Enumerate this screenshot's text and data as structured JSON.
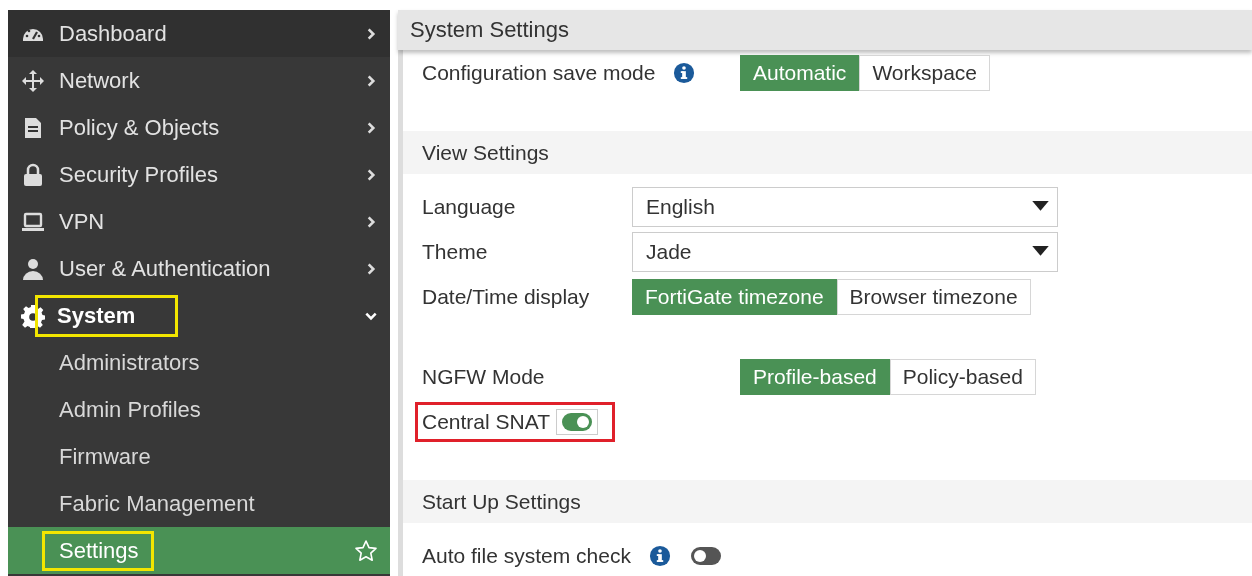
{
  "sidebar": {
    "items": [
      {
        "label": "Dashboard",
        "expanded": false,
        "selected": false,
        "highlight": false
      },
      {
        "label": "Network",
        "expanded": false,
        "selected": false,
        "highlight": false
      },
      {
        "label": "Policy & Objects",
        "expanded": false,
        "selected": false,
        "highlight": false
      },
      {
        "label": "Security Profiles",
        "expanded": false,
        "selected": false,
        "highlight": false
      },
      {
        "label": "VPN",
        "expanded": false,
        "selected": false,
        "highlight": false
      },
      {
        "label": "User & Authentication",
        "expanded": false,
        "selected": false,
        "highlight": false
      },
      {
        "label": "System",
        "expanded": true,
        "selected": false,
        "highlight": true,
        "children": [
          {
            "label": "Administrators",
            "selected": false,
            "highlight": false
          },
          {
            "label": "Admin Profiles",
            "selected": false,
            "highlight": false
          },
          {
            "label": "Firmware",
            "selected": false,
            "highlight": false
          },
          {
            "label": "Fabric Management",
            "selected": false,
            "highlight": false
          },
          {
            "label": "Settings",
            "selected": true,
            "highlight": true
          }
        ]
      }
    ]
  },
  "page": {
    "title": "System Settings",
    "sections": [
      {
        "groups": [
          [
            {
              "kind": "segmented",
              "label": "Configuration save mode",
              "info": true,
              "highlight": false,
              "options": [
                {
                  "label": "Automatic",
                  "selected": true
                },
                {
                  "label": "Workspace",
                  "selected": false
                }
              ]
            }
          ]
        ]
      },
      {
        "title": "View Settings",
        "groups": [
          [
            {
              "kind": "select",
              "label": "Language",
              "highlight": false,
              "value": "English"
            },
            {
              "kind": "select",
              "label": "Theme",
              "highlight": false,
              "value": "Jade"
            },
            {
              "kind": "segmented",
              "label": "Date/Time display",
              "highlight": false,
              "options": [
                {
                  "label": "FortiGate timezone",
                  "selected": true
                },
                {
                  "label": "Browser timezone",
                  "selected": false
                }
              ]
            }
          ],
          [
            {
              "kind": "segmented",
              "label": "NGFW Mode",
              "highlight": false,
              "options": [
                {
                  "label": "Profile-based",
                  "selected": true
                },
                {
                  "label": "Policy-based",
                  "selected": false
                }
              ]
            },
            {
              "kind": "toggle",
              "label": "Central SNAT",
              "highlight": true,
              "on": true
            }
          ]
        ]
      },
      {
        "title": "Start Up Settings",
        "groups": [
          [
            {
              "kind": "toggle",
              "label": "Auto file system check",
              "info": true,
              "highlight": false,
              "on": false
            }
          ]
        ]
      }
    ]
  }
}
